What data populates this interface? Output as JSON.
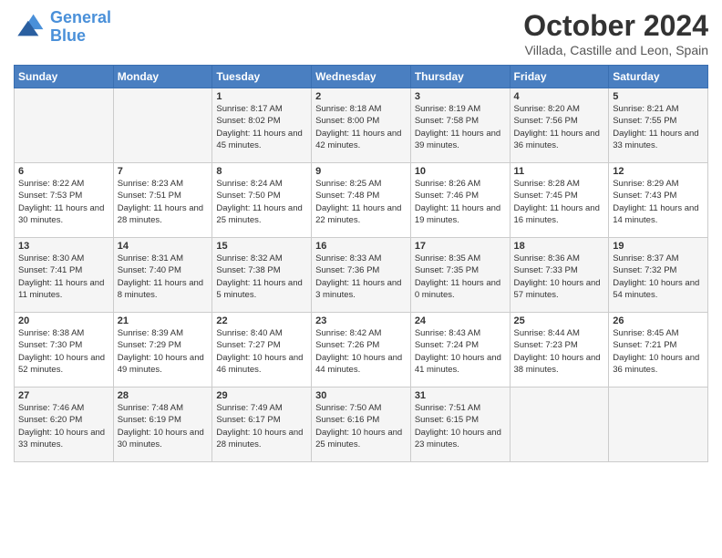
{
  "logo": {
    "line1": "General",
    "line2": "Blue"
  },
  "title": "October 2024",
  "location": "Villada, Castille and Leon, Spain",
  "days_of_week": [
    "Sunday",
    "Monday",
    "Tuesday",
    "Wednesday",
    "Thursday",
    "Friday",
    "Saturday"
  ],
  "weeks": [
    [
      {
        "num": "",
        "info": ""
      },
      {
        "num": "",
        "info": ""
      },
      {
        "num": "1",
        "info": "Sunrise: 8:17 AM\nSunset: 8:02 PM\nDaylight: 11 hours and 45 minutes."
      },
      {
        "num": "2",
        "info": "Sunrise: 8:18 AM\nSunset: 8:00 PM\nDaylight: 11 hours and 42 minutes."
      },
      {
        "num": "3",
        "info": "Sunrise: 8:19 AM\nSunset: 7:58 PM\nDaylight: 11 hours and 39 minutes."
      },
      {
        "num": "4",
        "info": "Sunrise: 8:20 AM\nSunset: 7:56 PM\nDaylight: 11 hours and 36 minutes."
      },
      {
        "num": "5",
        "info": "Sunrise: 8:21 AM\nSunset: 7:55 PM\nDaylight: 11 hours and 33 minutes."
      }
    ],
    [
      {
        "num": "6",
        "info": "Sunrise: 8:22 AM\nSunset: 7:53 PM\nDaylight: 11 hours and 30 minutes."
      },
      {
        "num": "7",
        "info": "Sunrise: 8:23 AM\nSunset: 7:51 PM\nDaylight: 11 hours and 28 minutes."
      },
      {
        "num": "8",
        "info": "Sunrise: 8:24 AM\nSunset: 7:50 PM\nDaylight: 11 hours and 25 minutes."
      },
      {
        "num": "9",
        "info": "Sunrise: 8:25 AM\nSunset: 7:48 PM\nDaylight: 11 hours and 22 minutes."
      },
      {
        "num": "10",
        "info": "Sunrise: 8:26 AM\nSunset: 7:46 PM\nDaylight: 11 hours and 19 minutes."
      },
      {
        "num": "11",
        "info": "Sunrise: 8:28 AM\nSunset: 7:45 PM\nDaylight: 11 hours and 16 minutes."
      },
      {
        "num": "12",
        "info": "Sunrise: 8:29 AM\nSunset: 7:43 PM\nDaylight: 11 hours and 14 minutes."
      }
    ],
    [
      {
        "num": "13",
        "info": "Sunrise: 8:30 AM\nSunset: 7:41 PM\nDaylight: 11 hours and 11 minutes."
      },
      {
        "num": "14",
        "info": "Sunrise: 8:31 AM\nSunset: 7:40 PM\nDaylight: 11 hours and 8 minutes."
      },
      {
        "num": "15",
        "info": "Sunrise: 8:32 AM\nSunset: 7:38 PM\nDaylight: 11 hours and 5 minutes."
      },
      {
        "num": "16",
        "info": "Sunrise: 8:33 AM\nSunset: 7:36 PM\nDaylight: 11 hours and 3 minutes."
      },
      {
        "num": "17",
        "info": "Sunrise: 8:35 AM\nSunset: 7:35 PM\nDaylight: 11 hours and 0 minutes."
      },
      {
        "num": "18",
        "info": "Sunrise: 8:36 AM\nSunset: 7:33 PM\nDaylight: 10 hours and 57 minutes."
      },
      {
        "num": "19",
        "info": "Sunrise: 8:37 AM\nSunset: 7:32 PM\nDaylight: 10 hours and 54 minutes."
      }
    ],
    [
      {
        "num": "20",
        "info": "Sunrise: 8:38 AM\nSunset: 7:30 PM\nDaylight: 10 hours and 52 minutes."
      },
      {
        "num": "21",
        "info": "Sunrise: 8:39 AM\nSunset: 7:29 PM\nDaylight: 10 hours and 49 minutes."
      },
      {
        "num": "22",
        "info": "Sunrise: 8:40 AM\nSunset: 7:27 PM\nDaylight: 10 hours and 46 minutes."
      },
      {
        "num": "23",
        "info": "Sunrise: 8:42 AM\nSunset: 7:26 PM\nDaylight: 10 hours and 44 minutes."
      },
      {
        "num": "24",
        "info": "Sunrise: 8:43 AM\nSunset: 7:24 PM\nDaylight: 10 hours and 41 minutes."
      },
      {
        "num": "25",
        "info": "Sunrise: 8:44 AM\nSunset: 7:23 PM\nDaylight: 10 hours and 38 minutes."
      },
      {
        "num": "26",
        "info": "Sunrise: 8:45 AM\nSunset: 7:21 PM\nDaylight: 10 hours and 36 minutes."
      }
    ],
    [
      {
        "num": "27",
        "info": "Sunrise: 7:46 AM\nSunset: 6:20 PM\nDaylight: 10 hours and 33 minutes."
      },
      {
        "num": "28",
        "info": "Sunrise: 7:48 AM\nSunset: 6:19 PM\nDaylight: 10 hours and 30 minutes."
      },
      {
        "num": "29",
        "info": "Sunrise: 7:49 AM\nSunset: 6:17 PM\nDaylight: 10 hours and 28 minutes."
      },
      {
        "num": "30",
        "info": "Sunrise: 7:50 AM\nSunset: 6:16 PM\nDaylight: 10 hours and 25 minutes."
      },
      {
        "num": "31",
        "info": "Sunrise: 7:51 AM\nSunset: 6:15 PM\nDaylight: 10 hours and 23 minutes."
      },
      {
        "num": "",
        "info": ""
      },
      {
        "num": "",
        "info": ""
      }
    ]
  ]
}
